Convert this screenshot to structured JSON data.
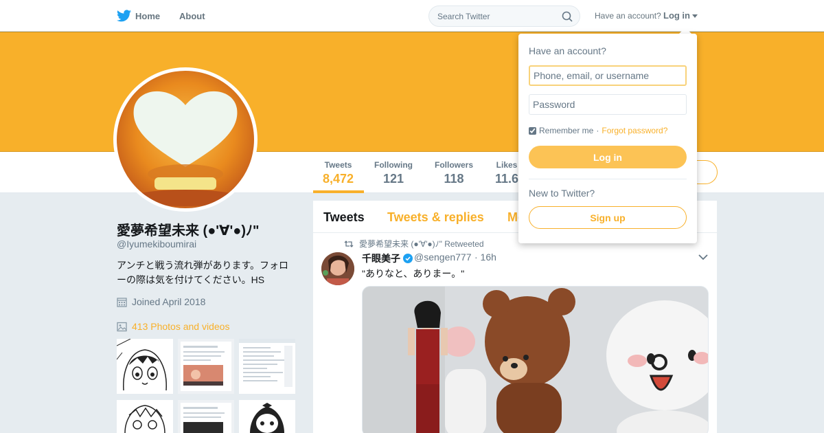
{
  "colors": {
    "accent": "#f8b02a",
    "banner": "#f8b02a",
    "text": "#14171a",
    "muted": "#657786"
  },
  "nav": {
    "home_label": "Home",
    "about_label": "About",
    "search_placeholder": "Search Twitter",
    "have_account": "Have an account?",
    "login_label": "Log in"
  },
  "profile": {
    "name": "愛夢希望未来 (●'∀'●)ﾉ\"",
    "handle": "@Iyumekiboumirai",
    "bio": "アンチと戦う流れ弾があります。フォローの際は気を付けてください。HS",
    "joined": "Joined April 2018",
    "photos": "413 Photos and videos"
  },
  "stats": [
    {
      "label": "Tweets",
      "value": "8,472"
    },
    {
      "label": "Following",
      "value": "121"
    },
    {
      "label": "Followers",
      "value": "118"
    },
    {
      "label": "Likes",
      "value": "11.6"
    }
  ],
  "timeline": {
    "tabs": [
      "Tweets",
      "Tweets & replies",
      "Media"
    ],
    "retweet_line": "愛夢希望未来 (●'∀'●)ﾉ\" Retweeted",
    "tweet": {
      "name": "千眼美子",
      "handle": "@sengen777",
      "time": "· 16h",
      "text": "\"ありなと、ありまー。\""
    }
  },
  "login_dropdown": {
    "title": "Have an account?",
    "username_placeholder": "Phone, email, or username",
    "password_placeholder": "Password",
    "remember": "Remember me",
    "sep": " · ",
    "forgot": "Forgot password?",
    "login_button": "Log in",
    "new_to": "New to Twitter?",
    "signup_button": "Sign up",
    "remember_checked": true
  },
  "icons": [
    "twitter-bird-icon",
    "search-icon",
    "calendar-icon",
    "photo-icon",
    "retweet-icon",
    "verified-icon",
    "chevron-down-icon"
  ]
}
